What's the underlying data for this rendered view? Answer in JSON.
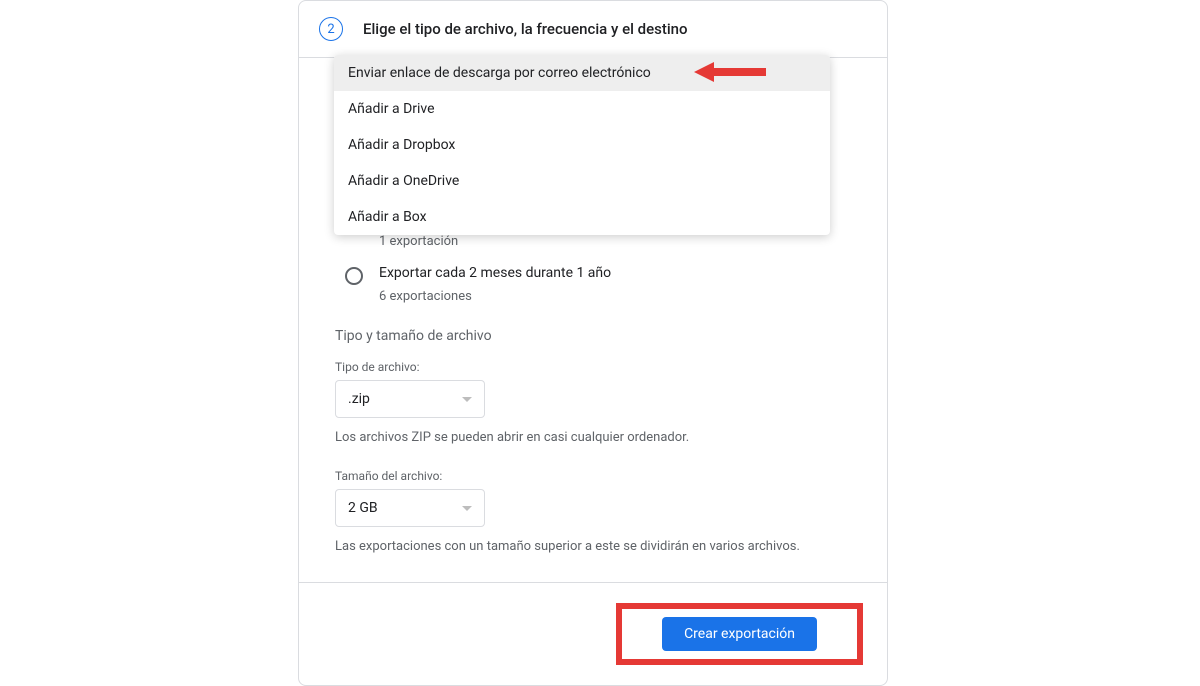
{
  "step": {
    "number": "2",
    "title": "Elige el tipo de archivo, la frecuencia y el destino"
  },
  "dropdown": {
    "items": [
      "Enviar enlace de descarga por correo electrónico",
      "Añadir a Drive",
      "Añadir a Dropbox",
      "Añadir a OneDrive",
      "Añadir a Box"
    ]
  },
  "frequency": {
    "option1_sub": "1 exportación",
    "option2_label": "Exportar cada 2 meses durante 1 año",
    "option2_sub": "6 exportaciones"
  },
  "fileSection": {
    "title": "Tipo y tamaño de archivo",
    "typeLabel": "Tipo de archivo:",
    "typeValue": ".zip",
    "typeHelp": "Los archivos ZIP se pueden abrir en casi cualquier ordenador.",
    "sizeLabel": "Tamaño del archivo:",
    "sizeValue": "2 GB",
    "sizeHelp": "Las exportaciones con un tamaño superior a este se dividirán en varios archivos."
  },
  "footer": {
    "createButton": "Crear exportación"
  }
}
